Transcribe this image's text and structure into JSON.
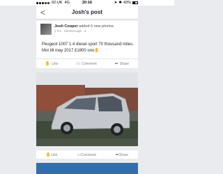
{
  "status_bar": {
    "carrier": "02-UK",
    "network": "4G",
    "time": "20:16",
    "battery_text": "43%",
    "battery_level": 0.43
  },
  "nav": {
    "back_label": "<",
    "title": "Josh's post"
  },
  "post": {
    "author": "Josh Cooper",
    "action_text": "added 6 new photos.",
    "meta": "2 hrs · Mexborough · ●",
    "body": "Peugeot 1007 1.4 diesel sport 70 thousand miles. Mot till may 2017 £1800 ono",
    "emoji_icon": "thumbs-up-emoji"
  },
  "actions": {
    "like_label": "Like",
    "comment_label": "Comment",
    "share_label": "Share"
  },
  "photo": {
    "description_icon": "car-photo"
  },
  "colors": {
    "background": "#e9ebee",
    "card": "#ffffff",
    "car_body": "#bfc3c7"
  }
}
